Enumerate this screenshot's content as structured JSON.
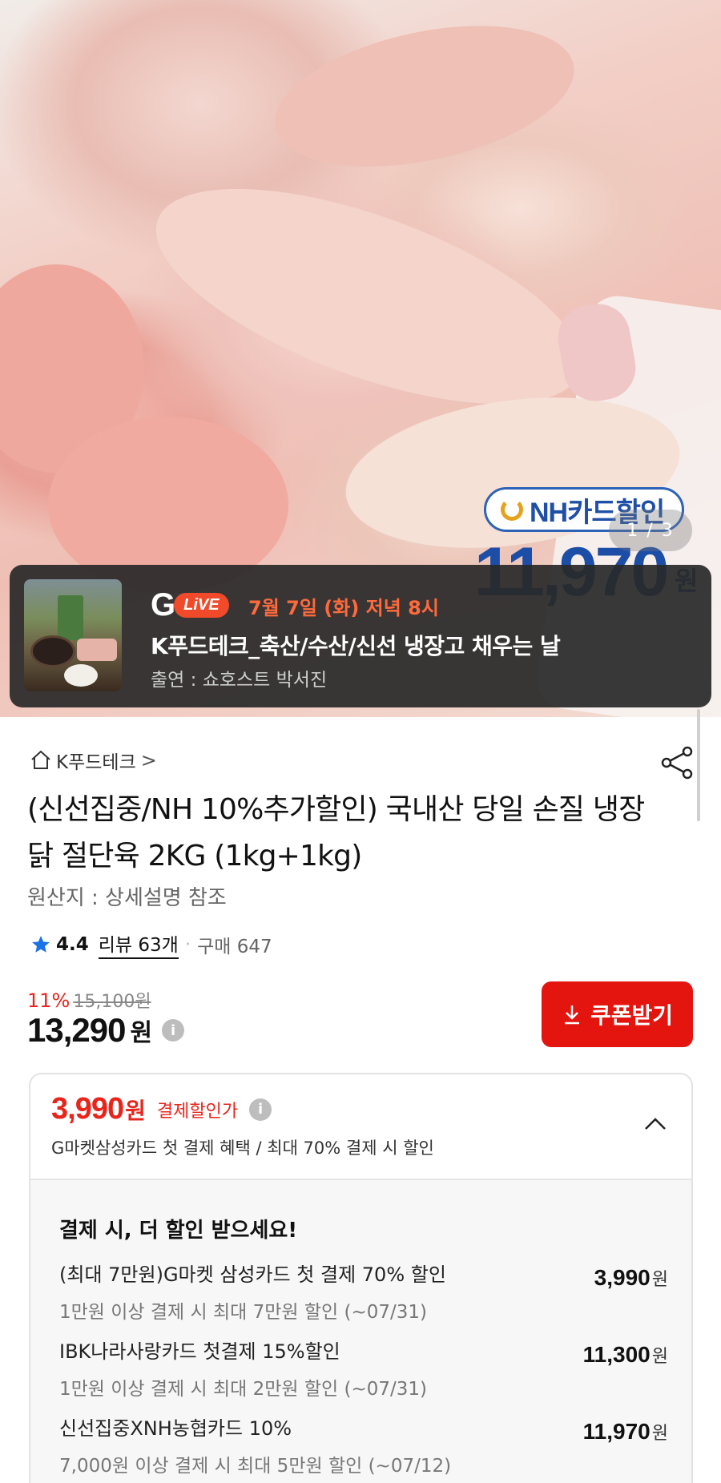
{
  "hero": {
    "nh_badge": "NH카드할인",
    "promo_price": "11,970",
    "promo_won": "원",
    "image_counter": "1 / 3"
  },
  "live": {
    "logo_g": "G",
    "logo_live": "LiVE",
    "date": "7월 7일 (화) 저녁 8시",
    "title": "K푸드테크_축산/수산/신선 냉장고 채우는 날",
    "host": "출연 : 쇼호스트 박서진"
  },
  "product": {
    "store": "K푸드테크",
    "store_chevron": ">",
    "title": "(신선집중/NH 10%추가할인) 국내산 당일 손질 냉장닭 절단육 2KG (1kg+1kg)",
    "origin": "원산지 : 상세설명 참조",
    "rating": "4.4",
    "reviews": "리뷰 63개",
    "sold": "구매 647",
    "discount_pct": "11%",
    "original_price": "15,100원",
    "price": "13,290",
    "price_won": "원",
    "coupon_button": "쿠폰받기"
  },
  "benefit": {
    "price": "3,990",
    "won": "원",
    "label": "결제할인가",
    "description": "G마켓삼성카드 첫 결제 혜택 / 최대 70% 결제 시 할인",
    "body_title": "결제 시, 더 할인 받으세요!",
    "offers": [
      {
        "name": "(최대 7만원)G마켓 삼성카드 첫 결제 70% 할인",
        "condition": "1만원 이상 결제 시 최대 7만원 할인 (~07/31)",
        "price": "3,990",
        "won": "원"
      },
      {
        "name": "IBK나라사랑카드 첫결제 15%할인",
        "condition": "1만원 이상 결제 시 최대 2만원 할인 (~07/31)",
        "price": "11,300",
        "won": "원"
      },
      {
        "name": "신선집중XNH농협카드 10%",
        "condition": "7,000원 이상 결제 시 최대 5만원 할인 (~07/12)",
        "price": "11,970",
        "won": "원"
      }
    ]
  },
  "icons": {
    "home": "home-icon",
    "share": "share-icon",
    "star": "star-icon",
    "info": "info-icon",
    "download": "download-icon",
    "collapse": "chevron-up-icon"
  },
  "colors": {
    "accent_red": "#e4140f",
    "price_red": "#e8241b",
    "live_orange": "#ff6a3d",
    "star_blue": "#1a73e8",
    "nh_blue": "#1c4ea8"
  }
}
